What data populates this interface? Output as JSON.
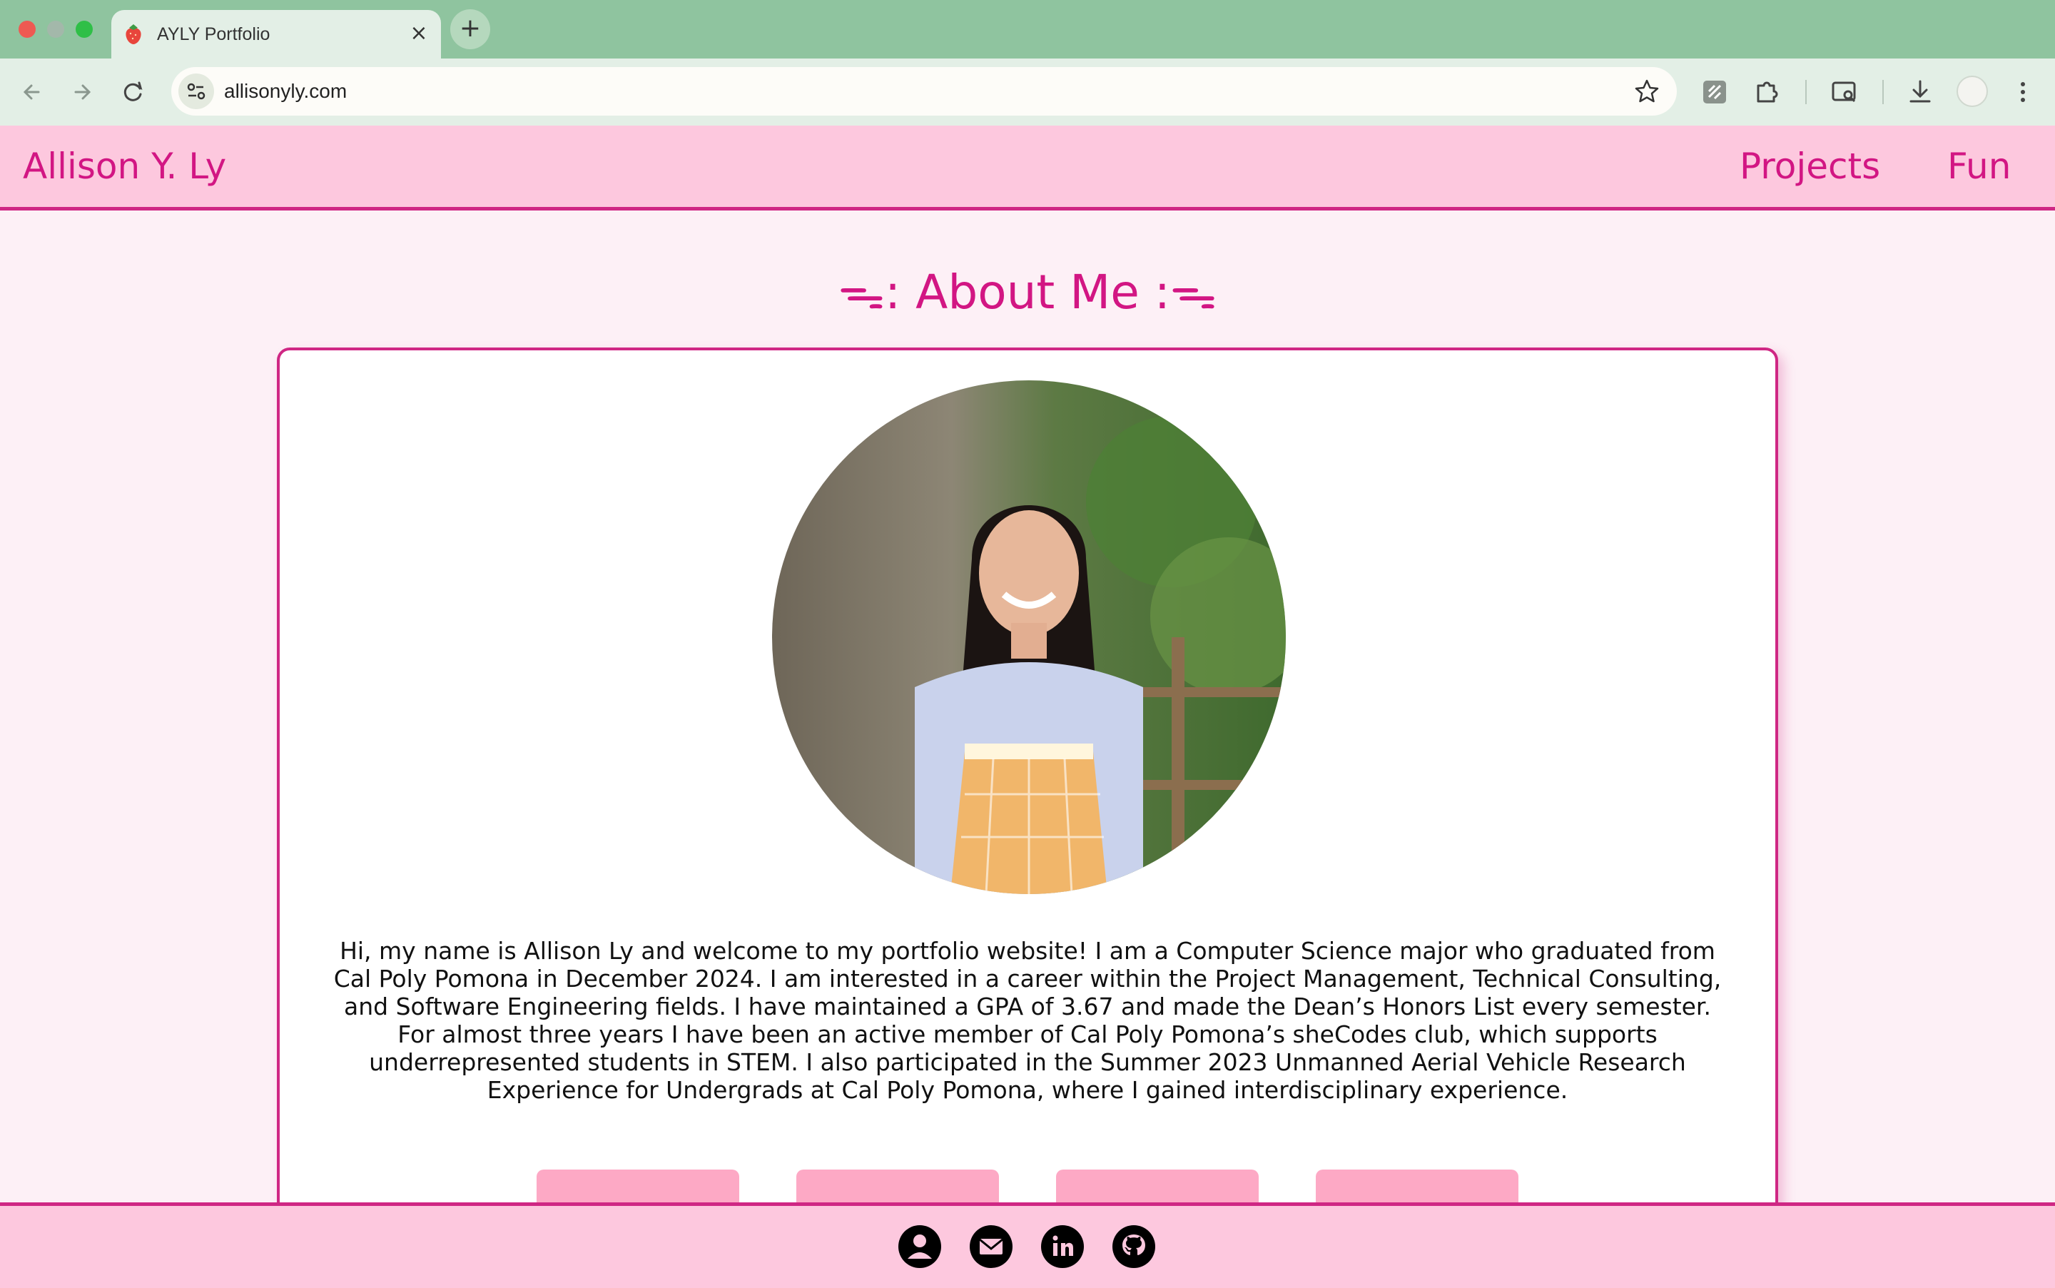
{
  "browser": {
    "tab_title": "AYLY Portfolio",
    "url": "allisonyly.com"
  },
  "header": {
    "brand": "Allison Y. Ly",
    "nav": [
      {
        "label": "Projects"
      },
      {
        "label": "Fun"
      }
    ]
  },
  "about": {
    "title": "ᯓ: About Me :ᯓ",
    "photo_alt": "profile-photo",
    "bio": "Hi, my name is Allison Ly and welcome to my portfolio website! I am a Computer Science major who graduated from Cal Poly Pomona in December 2024. I am interested in a career within the Project Management, Technical Consulting, and Software Engineering fields. I have maintained a GPA of 3.67 and made the Dean’s Honors List every semester. For almost three years I have been an active member of Cal Poly Pomona’s sheCodes club, which supports underrepresented students in STEM. I also participated in the Summer 2023 Unmanned Aerial Vehicle Research Experience for Undergrads at Cal Poly Pomona, where I gained interdisciplinary experience."
  },
  "footer": {
    "icons": [
      "person-icon",
      "mail-icon",
      "linkedin-icon",
      "github-icon"
    ]
  },
  "colors": {
    "accent": "#d21683",
    "header_bg": "#fdc8de",
    "page_bg": "#fdf0f6",
    "button": "#fda9c5",
    "browser_frame": "#8fc49f"
  }
}
